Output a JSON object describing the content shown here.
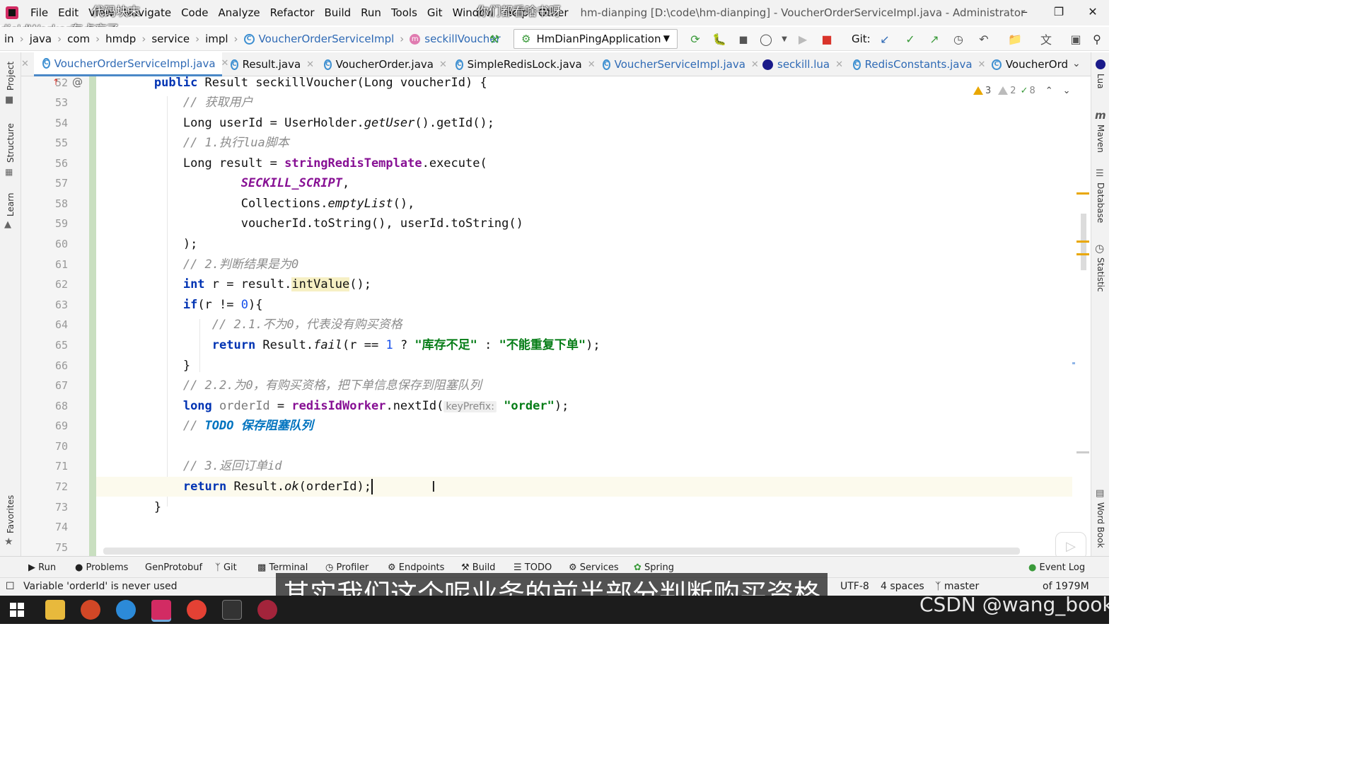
{
  "menubar": {
    "items": [
      "File",
      "Edit",
      "View",
      "Navigate",
      "Code",
      "Analyze",
      "Refactor",
      "Build",
      "Run",
      "Tools",
      "Git",
      "Window",
      "Help",
      "Other"
    ],
    "window_title": "hm-dianping [D:\\code\\hm-dianping] - VoucherOrderServiceImpl.java - Administrator"
  },
  "overlays": [
    "代码块末",
    "你们都看啥书呀",
    "disIdWorker有点忘了"
  ],
  "breadcrumb": [
    "in",
    "java",
    "com",
    "hmdp",
    "service",
    "impl",
    "VoucherOrderServiceImpl",
    "seckillVoucher"
  ],
  "run_config": "HmDianPingApplication",
  "git_label": "Git:",
  "tabs": [
    {
      "label": "VoucherOrderServiceImpl.java",
      "active": true
    },
    {
      "label": "Result.java"
    },
    {
      "label": "VoucherOrder.java"
    },
    {
      "label": "SimpleRedisLock.java"
    },
    {
      "label": "VoucherServiceImpl.java"
    },
    {
      "label": "seckill.lua"
    },
    {
      "label": "RedisConstants.java"
    },
    {
      "label": "VoucherOrd"
    }
  ],
  "left_tools": [
    "Project",
    "Structure",
    "Learn",
    "Favorites"
  ],
  "right_tools": [
    "Lua",
    "Maven",
    "Database",
    "Statistic",
    "Word Book"
  ],
  "inspections": {
    "warnings": "3",
    "weak": "2",
    "typos": "8"
  },
  "line_numbers": [
    "52",
    "53",
    "54",
    "55",
    "56",
    "57",
    "58",
    "59",
    "60",
    "61",
    "62",
    "63",
    "64",
    "65",
    "66",
    "67",
    "68",
    "69",
    "70",
    "71",
    "72",
    "73",
    "74",
    "75"
  ],
  "code": {
    "l52": {
      "kw": "public",
      "rest": " Result seckillVoucher(Long voucherId) {"
    },
    "l53": "// 获取用户",
    "l54": {
      "a": "Long userId = UserHolder.",
      "b": "getUser",
      "c": "().getId();"
    },
    "l55": "// 1.执行lua脚本",
    "l56": {
      "a": "Long result = ",
      "b": "stringRedisTemplate",
      "c": ".execute("
    },
    "l57": {
      "a": "SECKILL_SCRIPT",
      "b": ","
    },
    "l58": {
      "a": "Collections.",
      "b": "emptyList",
      "c": "(),"
    },
    "l59": "voucherId.toString(), userId.toString()",
    "l60": ");",
    "l61": "// 2.判断结果是为0",
    "l62": {
      "kw": "int",
      "a": " r = result.",
      "b": "intValue",
      "c": "();"
    },
    "l63": {
      "kw": "if",
      "a": "(r != ",
      "num": "0",
      "c": "){"
    },
    "l64": "// 2.1.不为0，代表没有购买资格",
    "l65": {
      "kw": "return",
      "a": " Result.",
      "b": "fail",
      "c": "(r == ",
      "num": "1",
      "d": " ? ",
      "s1": "\"库存不足\"",
      "e": " : ",
      "s2": "\"不能重复下单\"",
      "f": ");"
    },
    "l66": "}",
    "l67": "// 2.2.为0，有购买资格，把下单信息保存到阻塞队列",
    "l68": {
      "kw": "long",
      "a": " orderId",
      "b": " = ",
      "c": "redisIdWorker",
      "d": ".nextId(",
      "hint": "keyPrefix:",
      "s": "\"order\"",
      "e": ");"
    },
    "l69": {
      "a": "// ",
      "todo": "TODO 保存阻塞队列"
    },
    "l71": "// 3.返回订单id",
    "l72": {
      "kw": "return",
      "a": " Result.",
      "b": "ok",
      "c": "(orderId);"
    },
    "l73": "}"
  },
  "toolwindows": [
    "Run",
    "Problems",
    "GenProtobuf",
    "Git",
    "Terminal",
    "Profiler",
    "Endpoints",
    "Build",
    "TODO",
    "Services",
    "Spring",
    "Event Log"
  ],
  "status": {
    "message": "Variable 'orderId' is never used",
    "encoding": "UTF-8",
    "indent": "4 spaces",
    "branch": "master",
    "memory": "of 1979M"
  },
  "subtitle": "其实我们这个呢业务的前半部分判断购买资格",
  "watermark": "CSDN @wang_book",
  "colors": {
    "keyword": "#0033b3",
    "comment": "#8c8c8c",
    "string": "#067d17",
    "field": "#871094",
    "number": "#1750eb",
    "accent": "#4a88c7"
  }
}
